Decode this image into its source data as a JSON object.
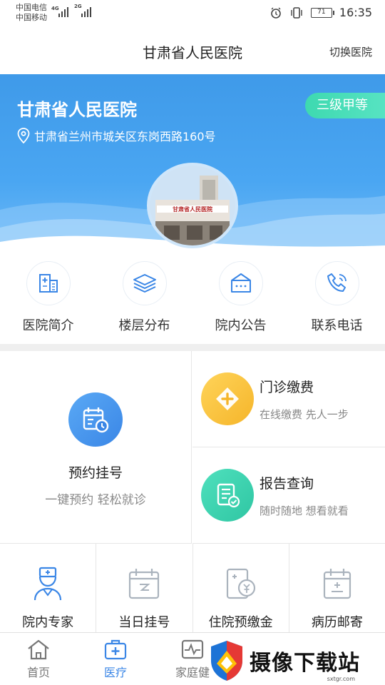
{
  "status": {
    "carrier1": "中国电信",
    "carrier2": "中国移动",
    "net1": "4G",
    "net2": "2G",
    "battery": "71",
    "time": "16:35"
  },
  "header": {
    "title": "甘肃省人民医院",
    "switch_label": "切换医院"
  },
  "banner": {
    "hospital_name": "甘肃省人民医院",
    "grade": "三级甲等",
    "address": "甘肃省兰州市城关区东岗西路160号",
    "photo_sign": "甘肃省人民医院"
  },
  "quick": [
    {
      "label": "医院简介",
      "icon": "building-icon"
    },
    {
      "label": "楼层分布",
      "icon": "layers-icon"
    },
    {
      "label": "院内公告",
      "icon": "notice-icon"
    },
    {
      "label": "联系电话",
      "icon": "phone-icon"
    }
  ],
  "services": {
    "appointment": {
      "title": "预约挂号",
      "sub": "一键预约 轻松就诊",
      "icon": "calendar-clock-icon"
    },
    "payment": {
      "title": "门诊缴费",
      "sub": "在线缴费 先人一步",
      "icon": "plus-diamond-icon",
      "color": "#f7c23a"
    },
    "report": {
      "title": "报告查询",
      "sub": "随时随地 想看就看",
      "icon": "report-icon",
      "color": "#3fd2b0"
    }
  },
  "bottom_services": [
    {
      "label": "院内专家",
      "icon": "doctor-icon"
    },
    {
      "label": "当日挂号",
      "icon": "today-calendar-icon"
    },
    {
      "label": "住院预缴金",
      "icon": "deposit-icon"
    },
    {
      "label": "病历邮寄",
      "icon": "record-mail-icon"
    }
  ],
  "tabs": [
    {
      "label": "首页",
      "icon": "home-icon"
    },
    {
      "label": "医疗",
      "icon": "medical-kit-icon"
    },
    {
      "label": "家庭健",
      "icon": "health-monitor-icon"
    }
  ],
  "watermark": {
    "text": "摄像下载站",
    "url": "sxtgr.com"
  },
  "colors": {
    "primary": "#3a86e6",
    "banner": "#4aa6f2",
    "badge": "#3ed9b0",
    "payment": "#f7c23a",
    "report": "#3fd2b0"
  }
}
